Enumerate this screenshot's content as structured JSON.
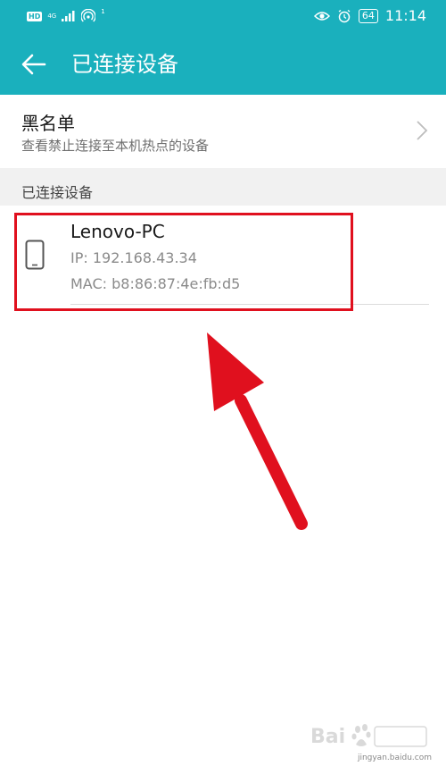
{
  "status_bar": {
    "hd_label": "HD",
    "network_label": "4G",
    "signal_sub": "1",
    "battery": "64",
    "time": "11:14"
  },
  "app_bar": {
    "title": "已连接设备"
  },
  "blacklist": {
    "title": "黑名单",
    "subtitle": "查看禁止连接至本机热点的设备"
  },
  "section": {
    "header": "已连接设备"
  },
  "device": {
    "name": "Lenovo-PC",
    "ip": "IP: 192.168.43.34",
    "mac": "MAC: b8:86:87:4e:fb:d5"
  },
  "watermark": {
    "text": "jingyan.baidu.com"
  },
  "colors": {
    "accent": "#1ab0bd",
    "annotation": "#e0101e"
  }
}
